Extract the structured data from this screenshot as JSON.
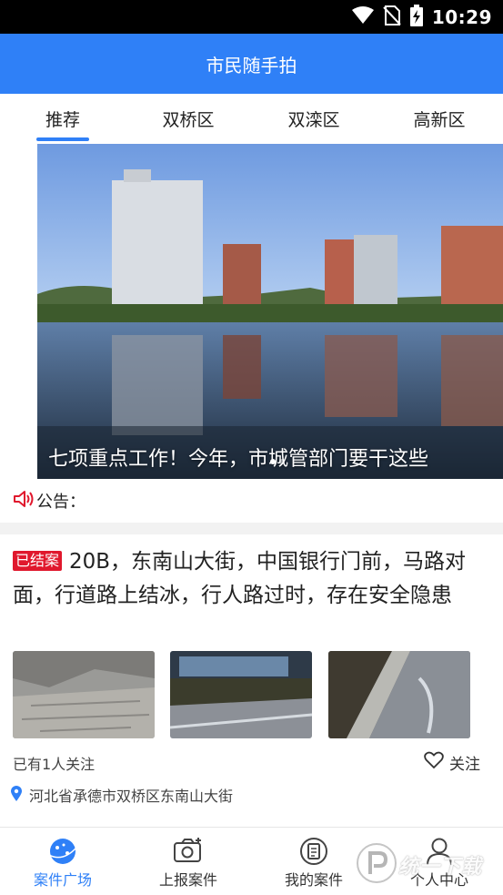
{
  "status_bar": {
    "time": "10:29"
  },
  "header": {
    "title": "市民随手拍"
  },
  "tabs": [
    {
      "label": "推荐"
    },
    {
      "label": "双桥区"
    },
    {
      "label": "双滦区"
    },
    {
      "label": "高新区"
    }
  ],
  "banner": {
    "caption": "七项重点工作！今年，市城管部门要干这些"
  },
  "notice": {
    "label": "公告："
  },
  "case": {
    "status_badge": "已结案",
    "description": "20B，东南山大街，中国银行门前，马路对面，行道路上结冰，行人路过时，存在安全隐患",
    "follow_count": "已有1人关注",
    "follow_label": "关注",
    "location": "河北省承德市双桥区东南山大街"
  },
  "bottom_nav": [
    {
      "label": "案件广场",
      "icon": "planet-icon",
      "active": true
    },
    {
      "label": "上报案件",
      "icon": "camera-icon",
      "active": false
    },
    {
      "label": "我的案件",
      "icon": "document-icon",
      "active": false
    },
    {
      "label": "个人中心",
      "icon": "user-icon",
      "active": false
    }
  ],
  "watermark": {
    "text": "统一下载"
  },
  "colors": {
    "accent": "#2f80f7",
    "badge": "#e0182d"
  }
}
